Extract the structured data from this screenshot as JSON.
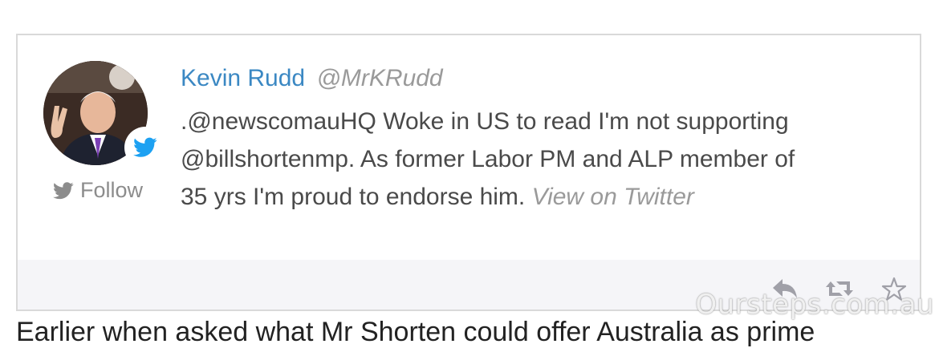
{
  "tweet": {
    "author_name": "Kevin Rudd",
    "author_handle": "@MrKRudd",
    "follow_label": "Follow",
    "text_lines": [
      ".@newscomauHQ Woke in US to read I'm not supporting",
      "@billshortenmp. As former Labor PM and ALP member of",
      "35 yrs I'm proud to endorse him."
    ],
    "view_link": "View on Twitter",
    "actions": [
      "reply-icon",
      "retweet-icon",
      "favorite-icon"
    ]
  },
  "watermark": "Oursteps.com.au",
  "article_continuation": "Earlier when asked what Mr Shorten could offer Australia as prime",
  "colors": {
    "author_name": "#3b88c3",
    "twitter_blue": "#1da1f2",
    "actions_bar": "#f5f5f8",
    "border": "#d9d9d9"
  }
}
